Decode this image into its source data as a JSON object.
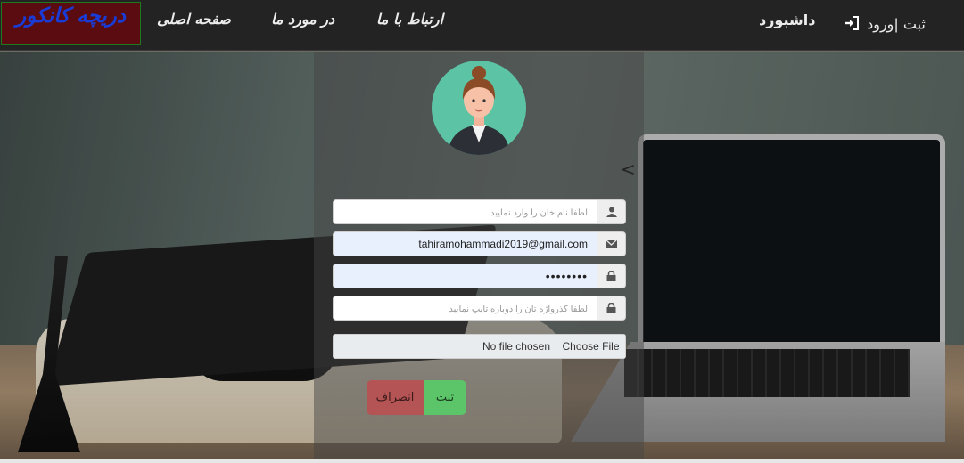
{
  "navbar": {
    "brand": "دریچه کانکور",
    "home": "صفحه اصلی",
    "about": "در مورد ما",
    "contact": "ارتباط با ما",
    "dashboard": "داشبورد",
    "login": "ثبت |ورود"
  },
  "form": {
    "name_placeholder": "لطفا نام خان را وارد نمایید",
    "email_value": "tahiramohammadi2019@gmail.com",
    "password_value": "••••••••",
    "password_confirm_placeholder": "لطفا گذرواژه تان را دوباره تایپ نمایید",
    "file_status": "No file chosen",
    "file_button": "Choose File",
    "submit_label": "ثبت",
    "cancel_label": "انصراف",
    "back_arrow": "<"
  },
  "icons": {
    "user": "user-icon",
    "email": "envelope-icon",
    "password": "lock-icon",
    "login": "sign-in-icon"
  },
  "colors": {
    "navbar": "#232323",
    "brand_bg": "#5a0c10",
    "brand_text": "#1a3cd6",
    "submit": "#5cc469",
    "cancel": "#b55454",
    "autofill": "#e8f0fe"
  }
}
